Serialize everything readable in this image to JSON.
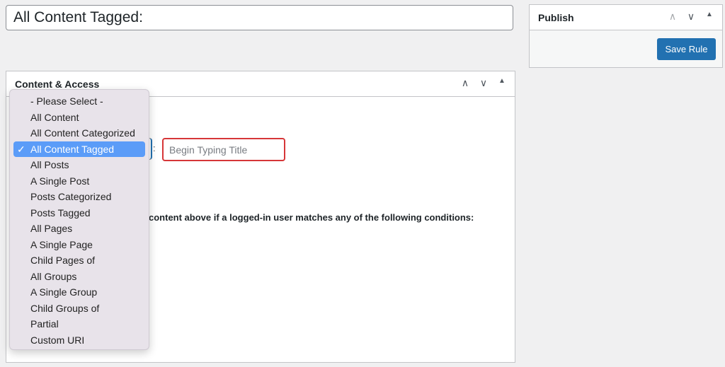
{
  "title_input": {
    "value": "All Content Tagged:"
  },
  "publish": {
    "title": "Publish",
    "save_label": "Save Rule"
  },
  "content_box": {
    "title": "Content & Access",
    "separator": ":",
    "title_search_placeholder": "Begin Typing Title",
    "conditions_text": "content above if a logged-in user matches any of the following conditions:"
  },
  "dropdown": {
    "selected": "All Content Tagged",
    "options": [
      "- Please Select -",
      "All Content",
      "All Content Categorized",
      "All Content Tagged",
      "All Posts",
      "A Single Post",
      "Posts Categorized",
      "Posts Tagged",
      "All Pages",
      "A Single Page",
      "Child Pages of",
      "All Groups",
      "A Single Group",
      "Child Groups of",
      "Partial",
      "Custom URI"
    ]
  },
  "icons": {
    "move_up": "chevron-up-icon",
    "move_down": "chevron-down-icon",
    "toggle": "triangle-up-icon",
    "check": "checkmark-icon"
  },
  "colors": {
    "primary": "#2271b1",
    "error_border": "#d63638",
    "selected_option": "#5b9cf8"
  }
}
